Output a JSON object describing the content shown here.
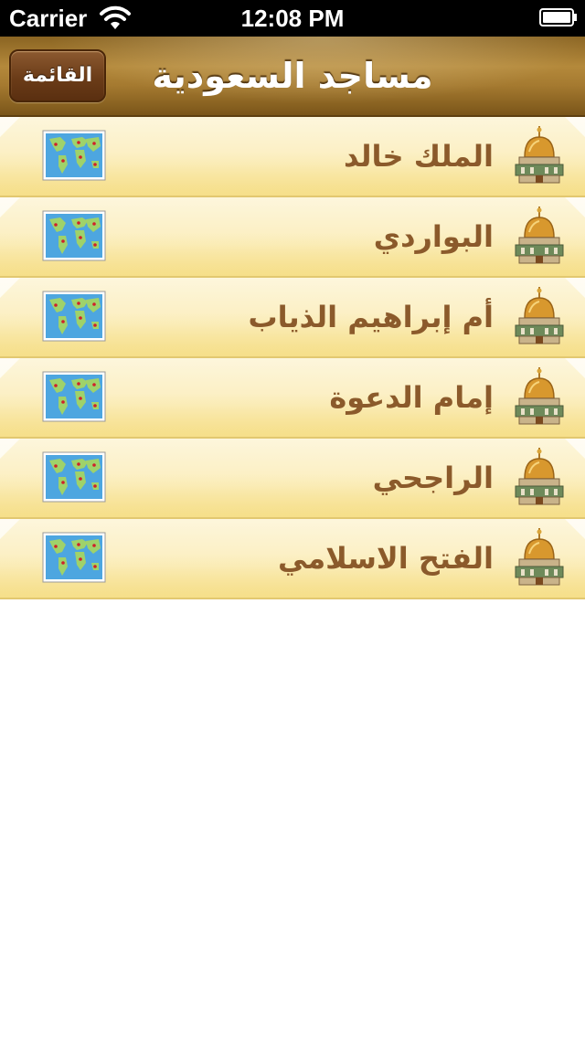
{
  "status_bar": {
    "carrier": "Carrier",
    "time": "12:08 PM",
    "wifi_icon": "wifi-icon",
    "battery_icon": "battery-icon"
  },
  "nav_bar": {
    "title": "مساجد السعودية",
    "menu_button_label": "القائمة"
  },
  "mosques": [
    {
      "name": "الملك خالد",
      "map_icon": "map-icon",
      "icon": "mosque-icon"
    },
    {
      "name": "البواردي",
      "map_icon": "map-icon",
      "icon": "mosque-icon"
    },
    {
      "name": "أم إبراهيم الذياب",
      "map_icon": "map-icon",
      "icon": "mosque-icon"
    },
    {
      "name": "إمام الدعوة",
      "map_icon": "map-icon",
      "icon": "mosque-icon"
    },
    {
      "name": "الراجحي",
      "map_icon": "map-icon",
      "icon": "mosque-icon"
    },
    {
      "name": "الفتح الاسلامي",
      "map_icon": "map-icon",
      "icon": "mosque-icon"
    }
  ],
  "colors": {
    "nav_brown": "#a57a30",
    "row_cream": "#fbeebe",
    "row_border": "#e2c870",
    "label_brown": "#8b5a2b",
    "button_brown": "#6b3c18"
  }
}
